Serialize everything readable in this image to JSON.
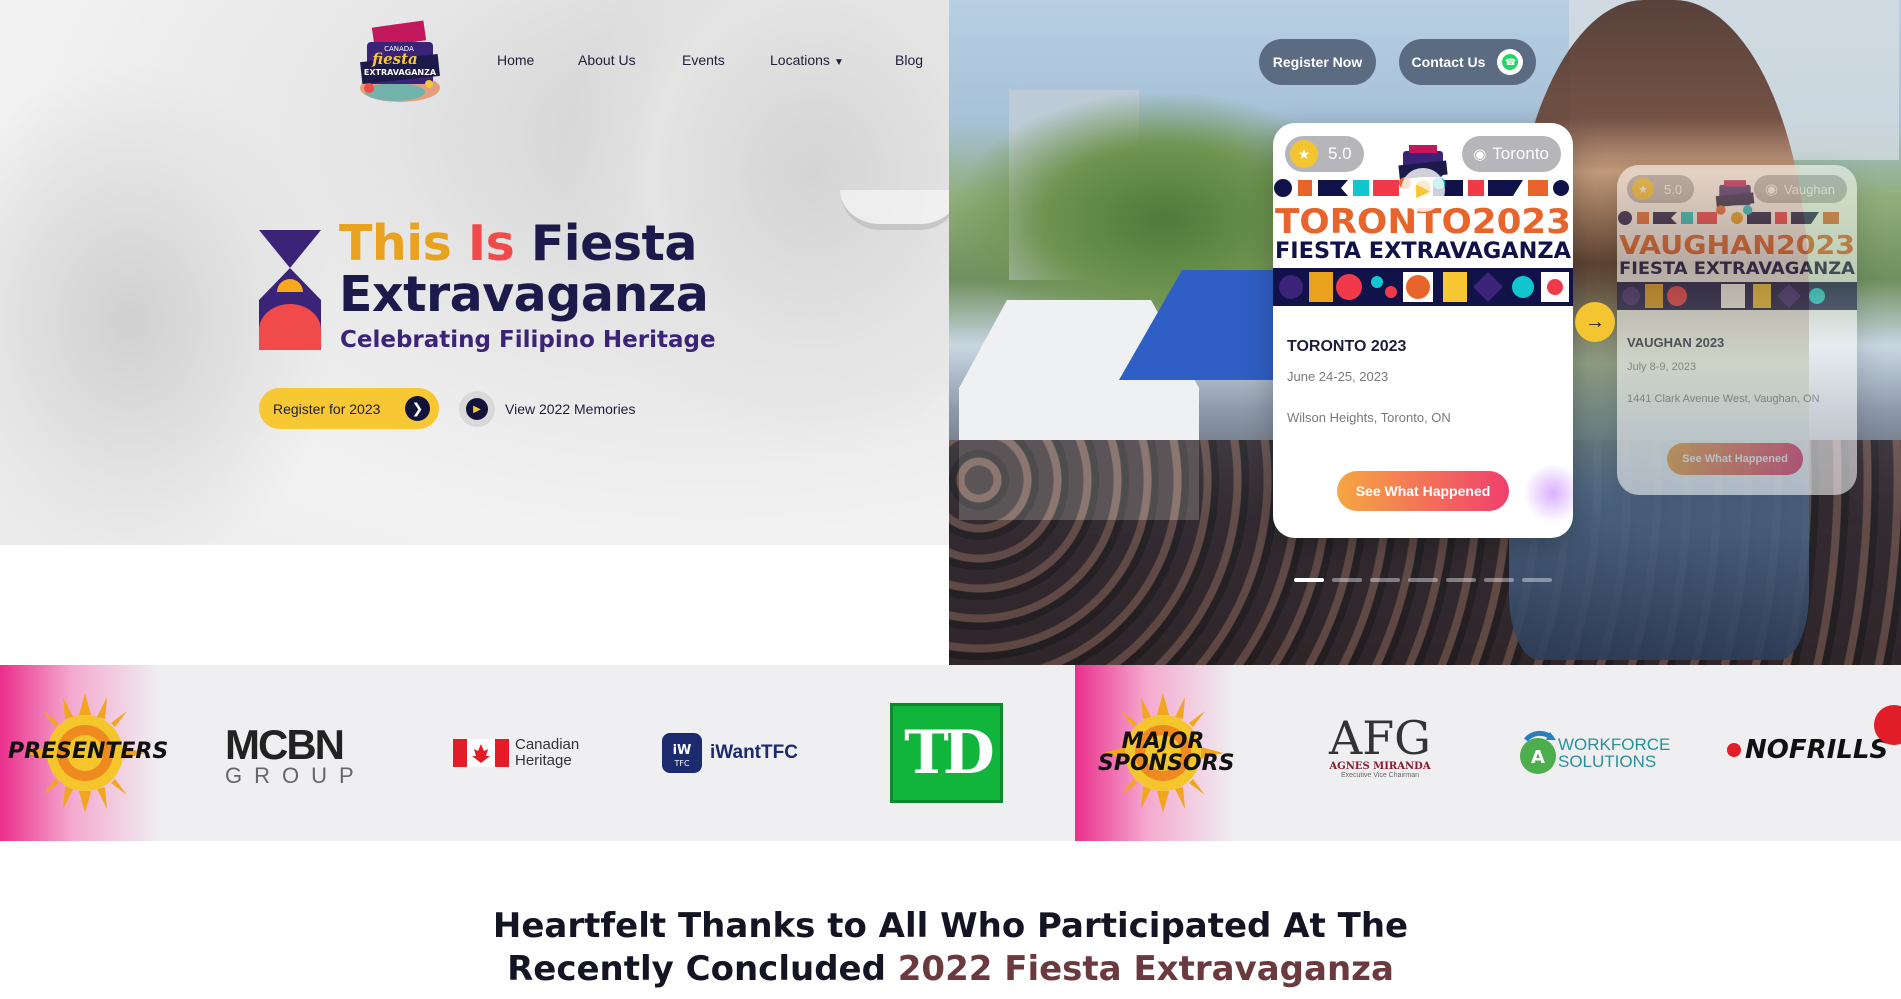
{
  "brand": {
    "logo_text_1": "CANADA",
    "logo_text_2": "fiesta",
    "logo_text_3": "EXTRAVAGANZA"
  },
  "nav": {
    "items": [
      {
        "label": "Home"
      },
      {
        "label": "About Us"
      },
      {
        "label": "Events"
      },
      {
        "label": "Locations",
        "has_dropdown": true
      },
      {
        "label": "Blog"
      }
    ]
  },
  "header_actions": {
    "register_label": "Register Now",
    "contact_label": "Contact Us"
  },
  "hero": {
    "title_word_1": "This",
    "title_word_2": "Is",
    "title_word_3": "Fiesta",
    "title_line_2": "Extravaganza",
    "subtitle": "Celebrating Filipino Heritage",
    "register_button": "Register for 2023",
    "memories_button": "View 2022 Memories"
  },
  "events": [
    {
      "rating": "5.0",
      "city": "Toronto",
      "banner_line_1": "TORONTO2023",
      "banner_line_2": "FIESTA EXTRAVAGANZA",
      "title": "TORONTO 2023",
      "date": "June 24-25, 2023",
      "location": "Wilson Heights, Toronto, ON",
      "button": "See What Happened"
    },
    {
      "rating": "5.0",
      "city": "Vaughan",
      "banner_line_1": "VAUGHAN2023",
      "banner_line_2": "FIESTA EXTRAVAGANZA",
      "title": "VAUGHAN 2023",
      "date": "July 8-9, 2023",
      "location": "1441 Clark Avenue West, Vaughan, ON",
      "button": "See What Happened"
    }
  ],
  "carousel": {
    "slide_count": 7,
    "active_index": 0
  },
  "sponsors": {
    "presenters_label": "PRESENTERS",
    "major_label_1": "MAJOR",
    "major_label_2": "SPONSORS",
    "mcbn_1": "MCBN",
    "mcbn_2": "GROUP",
    "canadian_heritage_1": "Canadian",
    "canadian_heritage_2": "Heritage",
    "iwant_badge": "iW",
    "iwant_badge_sub": "TFC",
    "iwant": "iWantTFC",
    "td": "TD",
    "agnes_mono": "AFG",
    "agnes_name": "AGNES MIRANDA",
    "agnes_sub": "Executive Vice Chairman",
    "workforce_1": "WORKFORCE",
    "workforce_2": "SOLUTIONS",
    "nofrills": "NOFRILLS"
  },
  "thanks": {
    "line_1": "Heartfelt Thanks to All Who Participated At The",
    "line_2_a": "Recently Concluded ",
    "line_2_b": "2022 Fiesta Extravaganza"
  },
  "colors": {
    "navy": "#13133a",
    "gold": "#e8a21d",
    "red": "#f04a4a",
    "purple": "#3b2477",
    "teal": "#12c6d0",
    "orange": "#e8642b",
    "yellow": "#f7c834"
  },
  "icons": {
    "chevron": "chevron-down-icon",
    "arrow": "arrow-right-icon",
    "play": "play-icon",
    "whatsapp": "whatsapp-icon",
    "star": "star-icon",
    "pin": "location-pin-icon"
  }
}
